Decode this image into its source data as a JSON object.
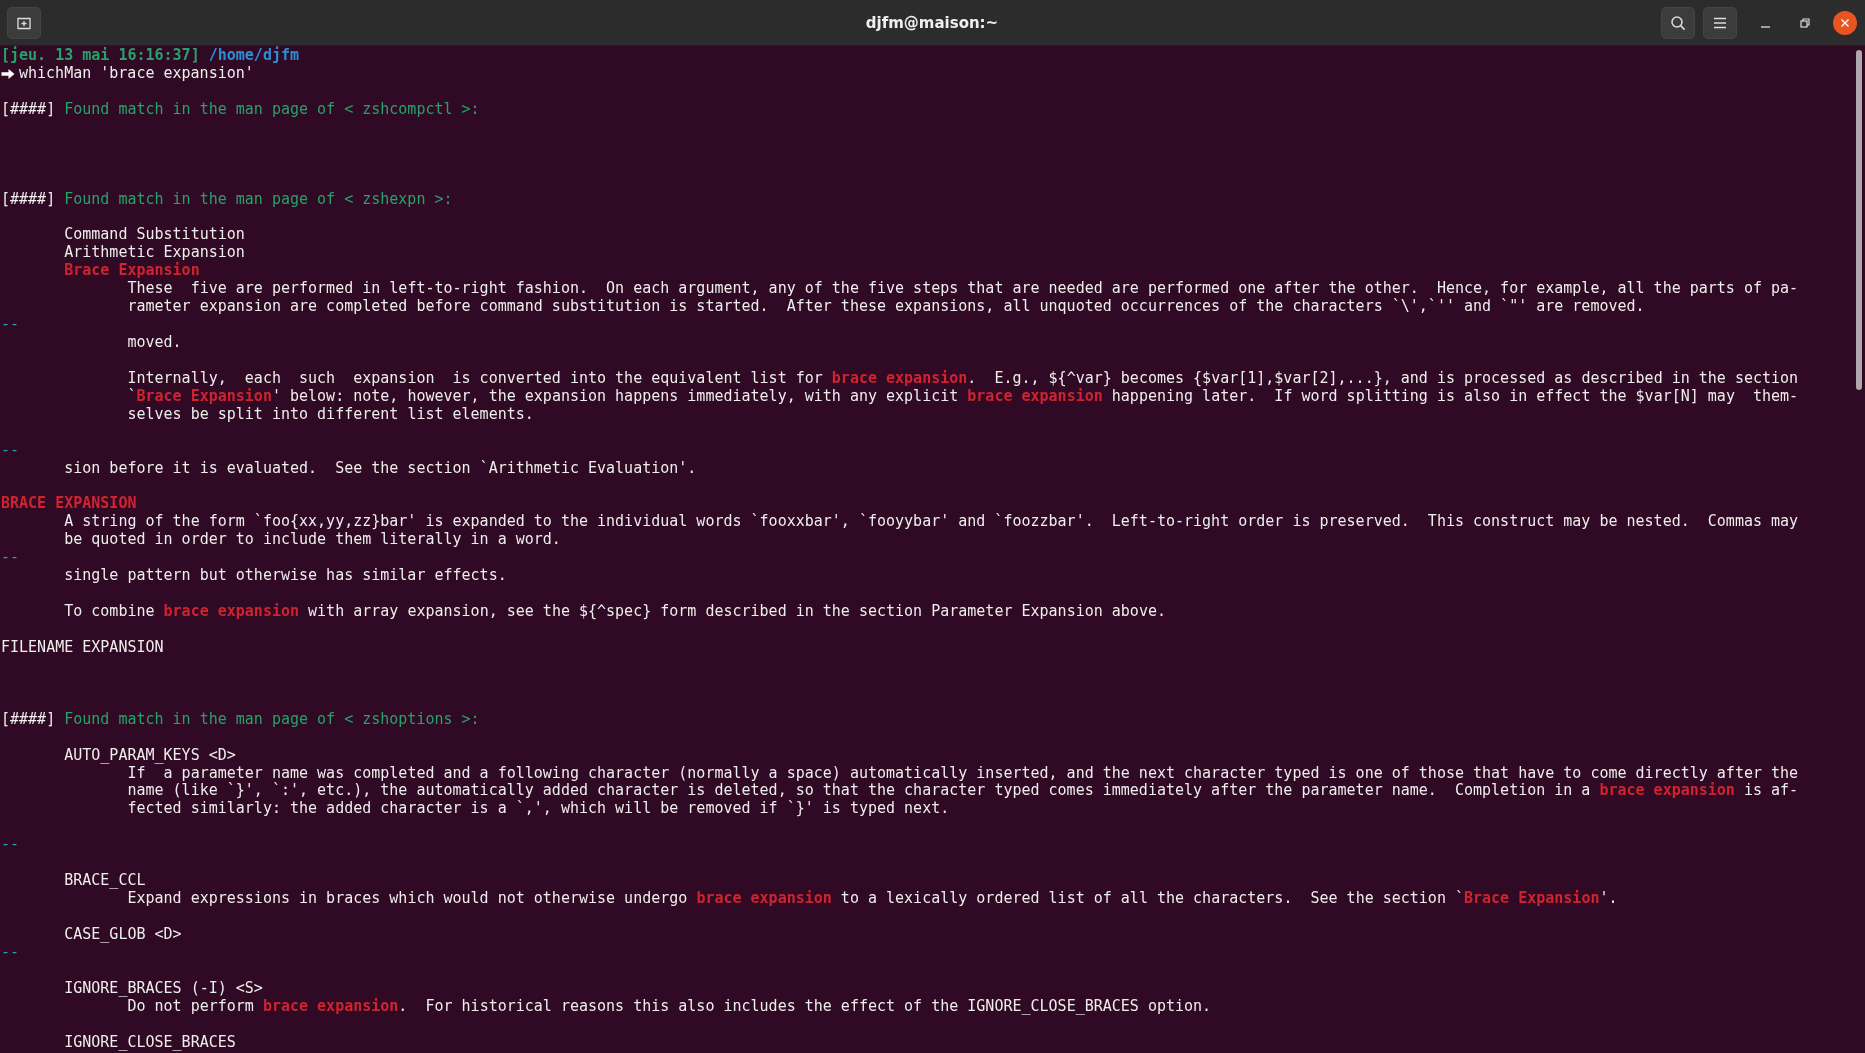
{
  "window": {
    "title": "djfm@maison:~"
  },
  "lines": [
    {
      "kind": "prompt",
      "time": "[jeu. 13 mai 16:16:37]",
      "path": "/home/djfm"
    },
    {
      "kind": "command",
      "text": "whichMan 'brace expansion'"
    },
    {
      "kind": "blank"
    },
    {
      "kind": "found",
      "marker": "[####]",
      "text": "Found match in the man page of < zshcompctl >:"
    },
    {
      "kind": "blank"
    },
    {
      "kind": "blank"
    },
    {
      "kind": "blank"
    },
    {
      "kind": "blank"
    },
    {
      "kind": "found",
      "marker": "[####]",
      "text": "Found match in the man page of < zshexpn >:"
    },
    {
      "kind": "blank"
    },
    {
      "kind": "item",
      "text": "Command Substitution",
      "highlight": false
    },
    {
      "kind": "item",
      "text": "Arithmetic Expansion",
      "highlight": false
    },
    {
      "kind": "item",
      "text": "Brace Expansion",
      "highlight": true
    },
    {
      "kind": "body",
      "text": "These  five are performed in left-to-right fashion.  On each argument, any of the five steps that are needed are performed one after the other.  Hence, for example, all the parts of pa-"
    },
    {
      "kind": "body",
      "text": "rameter expansion are completed before command substitution is started.  After these expansions, all unquoted occurrences of the characters `\\',`'' and `\"' are removed."
    },
    {
      "kind": "separator",
      "text": "--"
    },
    {
      "kind": "body",
      "text": "moved."
    },
    {
      "kind": "blank"
    },
    {
      "kind": "body",
      "text": "Internally,  each  such  expansion  is converted into the equivalent list for **brace expansion**.  E.g., ${^var} becomes {$var[1],$var[2],...}, and is processed as described in the section"
    },
    {
      "kind": "body",
      "text": "`**Brace Expansion**' below: note, however, the expansion happens immediately, with any explicit **brace expansion** happening later.  If word splitting is also in effect the $var[N] may  them-"
    },
    {
      "kind": "body",
      "text": "selves be split into different list elements."
    },
    {
      "kind": "blank"
    },
    {
      "kind": "separator",
      "text": "--"
    },
    {
      "kind": "item",
      "text": "sion before it is evaluated.  See the section `Arithmetic Evaluation'.",
      "highlight": false
    },
    {
      "kind": "blank"
    },
    {
      "kind": "heading",
      "text": "BRACE EXPANSION",
      "highlight": true
    },
    {
      "kind": "item",
      "text": "A string of the form `foo{xx,yy,zz}bar' is expanded to the individual words `fooxxbar', `fooyybar' and `foozzbar'.  Left-to-right order is preserved.  This construct may be nested.  Commas may",
      "highlight": false
    },
    {
      "kind": "item",
      "text": "be quoted in order to include them literally in a word.",
      "highlight": false
    },
    {
      "kind": "separator",
      "text": "--"
    },
    {
      "kind": "item",
      "text": "single pattern but otherwise has similar effects.",
      "highlight": false
    },
    {
      "kind": "blank"
    },
    {
      "kind": "item",
      "text": "To combine **brace expansion** with array expansion, see the ${^spec} form described in the section Parameter Expansion above.",
      "highlight": false
    },
    {
      "kind": "blank"
    },
    {
      "kind": "heading",
      "text": "FILENAME EXPANSION",
      "highlight": false
    },
    {
      "kind": "blank"
    },
    {
      "kind": "blank"
    },
    {
      "kind": "blank"
    },
    {
      "kind": "found",
      "marker": "[####]",
      "text": "Found match in the man page of < zshoptions >:"
    },
    {
      "kind": "blank"
    },
    {
      "kind": "item",
      "text": "AUTO_PARAM_KEYS <D>",
      "highlight": false
    },
    {
      "kind": "body",
      "text": "If  a parameter name was completed and a following character (normally a space) automatically inserted, and the next character typed is one of those that have to come directly after the"
    },
    {
      "kind": "body",
      "text": "name (like `}', `:', etc.), the automatically added character is deleted, so that the character typed comes immediately after the parameter name.  Completion in a **brace expansion** is af-"
    },
    {
      "kind": "body",
      "text": "fected similarly: the added character is a `,', which will be removed if `}' is typed next."
    },
    {
      "kind": "blank"
    },
    {
      "kind": "separator",
      "text": "--"
    },
    {
      "kind": "blank"
    },
    {
      "kind": "item",
      "text": "BRACE_CCL",
      "highlight": false
    },
    {
      "kind": "body",
      "text": "Expand expressions in braces which would not otherwise undergo **brace expansion** to a lexically ordered list of all the characters.  See the section `**Brace Expansion**'."
    },
    {
      "kind": "blank"
    },
    {
      "kind": "item",
      "text": "CASE_GLOB <D>",
      "highlight": false
    },
    {
      "kind": "separator",
      "text": "--"
    },
    {
      "kind": "blank"
    },
    {
      "kind": "item",
      "text": "IGNORE_BRACES (-I) <S>",
      "highlight": false
    },
    {
      "kind": "body",
      "text": "Do not perform **brace expansion**.  For historical reasons this also includes the effect of the IGNORE_CLOSE_BRACES option."
    },
    {
      "kind": "blank"
    },
    {
      "kind": "item",
      "text": "IGNORE_CLOSE_BRACES",
      "highlight": false
    }
  ]
}
